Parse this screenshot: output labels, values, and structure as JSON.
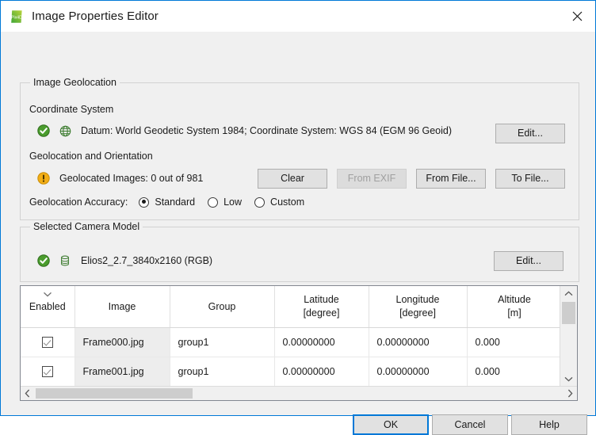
{
  "window": {
    "title": "Image Properties Editor",
    "app_icon": "pix4d-leaf-icon",
    "close_label": "✕",
    "accent_color": "#0078d7",
    "titlebar_bg": "#ffffff",
    "dialog_bg": "#f0f0f0"
  },
  "geolocation_group": {
    "title": "Image Geolocation",
    "coordinate_system": {
      "label": "Coordinate System",
      "status_icon": "green-check-circle-icon",
      "type_icon": "globe-icon",
      "value": "Datum: World Geodetic System 1984; Coordinate System: WGS 84 (EGM 96 Geoid)",
      "edit_button": "Edit..."
    },
    "orientation": {
      "label": "Geolocation and Orientation",
      "status_icon": "warning-exclamation-icon",
      "status_text": "Geolocated Images: 0 out of 981",
      "buttons": [
        {
          "label": "Clear",
          "enabled": true
        },
        {
          "label": "From EXIF",
          "enabled": false
        },
        {
          "label": "From File...",
          "enabled": true
        },
        {
          "label": "To File...",
          "enabled": true
        }
      ]
    },
    "accuracy": {
      "label": "Geolocation Accuracy:",
      "options": [
        "Standard",
        "Low",
        "Custom"
      ],
      "selected": "Standard"
    }
  },
  "camera_group": {
    "title": "Selected Camera Model",
    "status_icon": "green-check-circle-icon",
    "type_icon": "database-icon",
    "value": "Elios2_2.7_3840x2160 (RGB)",
    "edit_button": "Edit..."
  },
  "table": {
    "columns": [
      {
        "label": "Enabled",
        "unit": ""
      },
      {
        "label": "Image",
        "unit": ""
      },
      {
        "label": "Group",
        "unit": ""
      },
      {
        "label": "Latitude",
        "unit": "[degree]"
      },
      {
        "label": "Longitude",
        "unit": "[degree]"
      },
      {
        "label": "Altitude",
        "unit": "[m]"
      }
    ],
    "rows": [
      {
        "enabled": true,
        "image": "Frame000.jpg",
        "group": "group1",
        "latitude": "0.00000000",
        "longitude": "0.00000000",
        "altitude": "0.000"
      },
      {
        "enabled": true,
        "image": "Frame001.jpg",
        "group": "group1",
        "latitude": "0.00000000",
        "longitude": "0.00000000",
        "altitude": "0.000"
      }
    ],
    "scroll": {
      "vertical_up_icon": "chevron-up-icon",
      "vertical_down_icon": "chevron-down-icon",
      "horizontal_left_icon": "chevron-left-icon",
      "horizontal_right_icon": "chevron-right-icon"
    }
  },
  "footer": {
    "ok": "OK",
    "cancel": "Cancel",
    "help": "Help"
  }
}
